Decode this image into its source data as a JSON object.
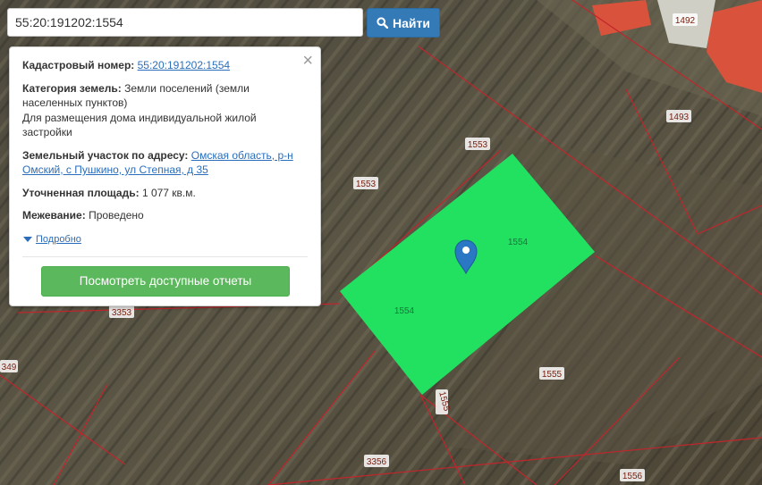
{
  "search": {
    "value": "55:20:191202:1554",
    "button_label": "Найти"
  },
  "info_panel": {
    "cadastral_label": "Кадастровый номер:",
    "cadastral_value": "55:20:191202:1554",
    "category_label": "Категория земель:",
    "category_value": "Земли поселений (земли населенных пунктов)",
    "purpose": "Для размещения дома индивидуальной жилой застройки",
    "address_label": "Земельный участок по адресу:",
    "address_value": "Омская область, р-н Омский, с Пушкино, ул Степная, д 35",
    "area_label": "Уточненная площадь:",
    "area_value": "1 077 кв.м.",
    "survey_label": "Межевание:",
    "survey_value": "Проведено",
    "details_link": "Подробно",
    "reports_button": "Посмотреть доступные отчеты"
  },
  "map": {
    "parcel_labels": [
      "1492",
      "1493",
      "1553",
      "1553",
      "1554",
      "1554",
      "1555",
      "1555",
      "1556",
      "3353",
      "3356",
      "349"
    ],
    "highlight_color": "#22e060",
    "boundary_color": "#c0262c",
    "marker_color": "#2a78c4"
  }
}
